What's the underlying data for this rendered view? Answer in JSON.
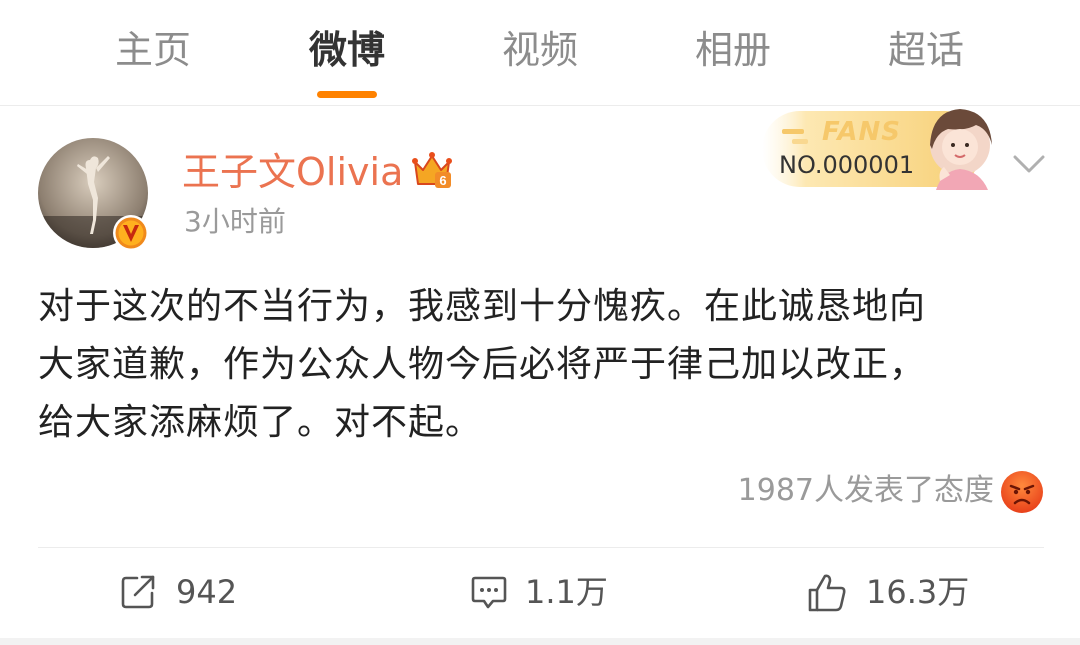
{
  "colors": {
    "accent": "#ff8200",
    "username": "#eb7350",
    "muted": "#9a9a9a",
    "text": "#222222",
    "fans_gold": "#f6c86a"
  },
  "tabs": [
    {
      "label": "主页",
      "active": false
    },
    {
      "label": "微博",
      "active": true
    },
    {
      "label": "视频",
      "active": false
    },
    {
      "label": "相册",
      "active": false
    },
    {
      "label": "超话",
      "active": false
    }
  ],
  "post": {
    "author": "王子文Olivia",
    "time": "3小时前",
    "badges": {
      "verified": "verified-v-icon",
      "crown": "crown-icon",
      "crown_level": "6"
    },
    "fans_badge": {
      "label": "FANS",
      "number": "NO.000001"
    },
    "body_lines": [
      "对于这次的不当行为，我感到十分愧疚。在此诚恳地向",
      "大家道歉，作为公众人物今后必将严于律己加以改正，",
      "给大家添麻烦了。对不起。"
    ],
    "reaction": {
      "text": "1987人发表了态度",
      "icon": "angry-face-icon"
    },
    "actions": {
      "repost": "942",
      "comment": "1.1万",
      "like": "16.3万"
    }
  }
}
